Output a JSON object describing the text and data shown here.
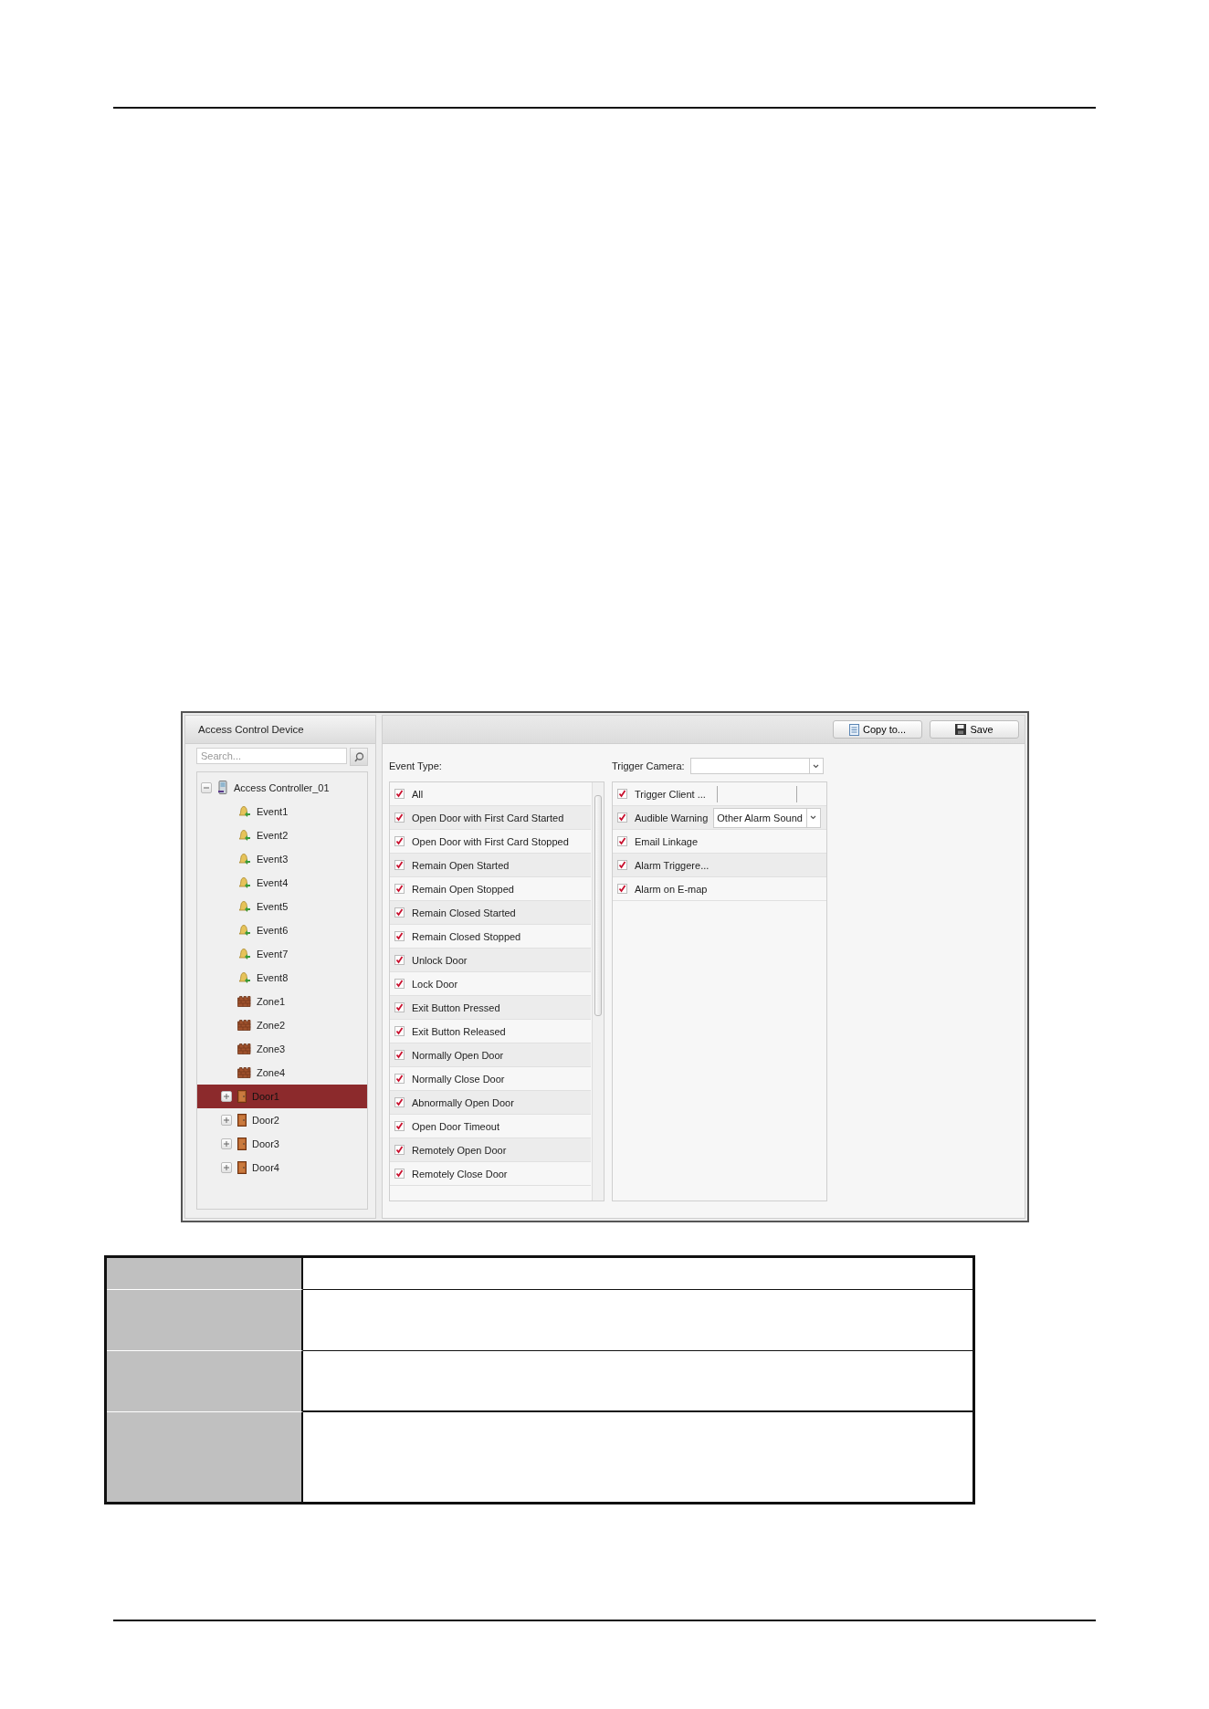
{
  "device_panel": {
    "title": "Access Control Device",
    "search": {
      "placeholder": "Search..."
    },
    "tree": [
      {
        "label": "Access Controller_01",
        "kind": "controller",
        "expanded": true,
        "selected": false,
        "children": [
          {
            "label": "Event1",
            "kind": "event",
            "selected": false
          },
          {
            "label": "Event2",
            "kind": "event",
            "selected": false
          },
          {
            "label": "Event3",
            "kind": "event",
            "selected": false
          },
          {
            "label": "Event4",
            "kind": "event",
            "selected": false
          },
          {
            "label": "Event5",
            "kind": "event",
            "selected": false
          },
          {
            "label": "Event6",
            "kind": "event",
            "selected": false
          },
          {
            "label": "Event7",
            "kind": "event",
            "selected": false
          },
          {
            "label": "Event8",
            "kind": "event",
            "selected": false
          },
          {
            "label": "Zone1",
            "kind": "zone",
            "selected": false
          },
          {
            "label": "Zone2",
            "kind": "zone",
            "selected": false
          },
          {
            "label": "Zone3",
            "kind": "zone",
            "selected": false
          },
          {
            "label": "Zone4",
            "kind": "zone",
            "selected": false
          },
          {
            "label": "Door1",
            "kind": "door",
            "expanded": false,
            "selected": true
          },
          {
            "label": "Door2",
            "kind": "door",
            "expanded": false,
            "selected": false
          },
          {
            "label": "Door3",
            "kind": "door",
            "expanded": false,
            "selected": false
          },
          {
            "label": "Door4",
            "kind": "door",
            "expanded": false,
            "selected": false
          }
        ]
      }
    ]
  },
  "toolbar": {
    "buttons": [
      {
        "label": "Copy to...",
        "kind": "copy"
      },
      {
        "label": "Save",
        "kind": "save"
      }
    ]
  },
  "event_type": {
    "label": "Event Type:",
    "items": [
      {
        "label": "All",
        "checked": true
      },
      {
        "label": "Open Door with First Card Started",
        "checked": true
      },
      {
        "label": "Open Door with First Card Stopped",
        "checked": true
      },
      {
        "label": "Remain Open Started",
        "checked": true
      },
      {
        "label": "Remain Open Stopped",
        "checked": true
      },
      {
        "label": "Remain Closed Started",
        "checked": true
      },
      {
        "label": "Remain Closed Stopped",
        "checked": true
      },
      {
        "label": "Unlock Door",
        "checked": true
      },
      {
        "label": "Lock Door",
        "checked": true
      },
      {
        "label": "Exit Button Pressed",
        "checked": true
      },
      {
        "label": "Exit Button Released",
        "checked": true
      },
      {
        "label": "Normally Open Door",
        "checked": true
      },
      {
        "label": "Normally Close Door",
        "checked": true
      },
      {
        "label": "Abnormally Open Door",
        "checked": true
      },
      {
        "label": "Open Door Timeout",
        "checked": true
      },
      {
        "label": "Remotely Open Door",
        "checked": true
      },
      {
        "label": "Remotely Close Door",
        "checked": true
      }
    ]
  },
  "trigger_camera": {
    "label": "Trigger Camera:"
  },
  "linkage": [
    {
      "label": "Trigger Client ...",
      "checked": true,
      "kind": "field"
    },
    {
      "label": "Audible Warning",
      "checked": true,
      "kind": "select",
      "value": "Other Alarm Sound"
    },
    {
      "label": "Email Linkage",
      "checked": true,
      "kind": "plain"
    },
    {
      "label": "Alarm Triggere...",
      "checked": true,
      "kind": "plain"
    },
    {
      "label": "Alarm on E-map",
      "checked": true,
      "kind": "plain"
    }
  ]
}
